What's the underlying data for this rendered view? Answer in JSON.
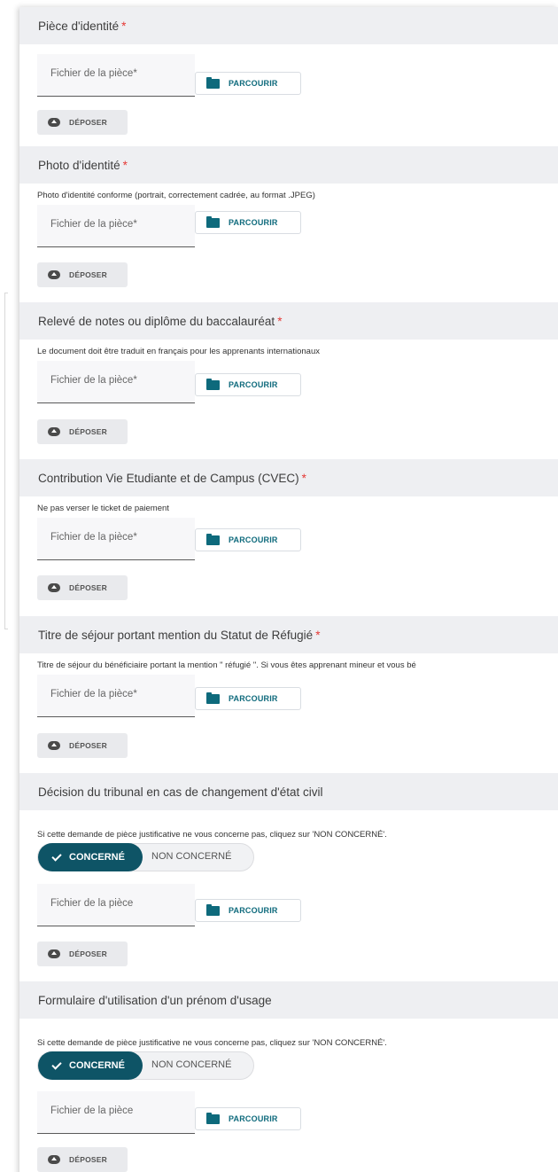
{
  "sections": [
    {
      "title": "Pièce d'identité",
      "required": "*",
      "description": "",
      "file_placeholder": "Fichier de la pièce*",
      "browse_label": "PARCOURIR",
      "upload_label": "DÉPOSER"
    },
    {
      "title": "Photo d'identité",
      "required": "*",
      "description": "Photo d'identité conforme (portrait, correctement cadrée, au format .JPEG)",
      "file_placeholder": "Fichier de la pièce*",
      "browse_label": "PARCOURIR",
      "upload_label": "DÉPOSER"
    },
    {
      "title": "Relevé de notes ou diplôme du baccalauréat",
      "required": "*",
      "description": "Le document doit être traduit en français pour les apprenants internationaux",
      "file_placeholder": "Fichier de la pièce*",
      "browse_label": "PARCOURIR",
      "upload_label": "DÉPOSER"
    },
    {
      "title": "Contribution Vie Etudiante et de Campus (CVEC)",
      "required": "*",
      "description": "Ne pas verser le ticket de paiement",
      "file_placeholder": "Fichier de la pièce*",
      "browse_label": "PARCOURIR",
      "upload_label": "DÉPOSER"
    },
    {
      "title": "Titre de séjour portant mention du Statut de Réfugié",
      "required": "*",
      "description": "Titre de séjour du bénéficiaire portant la mention \" réfugié \". Si vous êtes apprenant mineur et vous bé",
      "file_placeholder": "Fichier de la pièce*",
      "browse_label": "PARCOURIR",
      "upload_label": "DÉPOSER"
    },
    {
      "title": "Décision du tribunal en cas de changement d'état civil",
      "required": "",
      "description": "Si cette demande de pièce justificative ne vous concerne pas, cliquez sur 'NON CONCERNÉ'.",
      "toggle_on": "CONCERNÉ",
      "toggle_off": "NON CONCERNÉ",
      "file_placeholder": "Fichier de la pièce",
      "browse_label": "PARCOURIR",
      "upload_label": "DÉPOSER"
    },
    {
      "title": "Formulaire d'utilisation d'un prénom d'usage",
      "required": "",
      "description": "Si cette demande de pièce justificative ne vous concerne pas, cliquez sur 'NON CONCERNÉ'.",
      "toggle_on": "CONCERNÉ",
      "toggle_off": "NON CONCERNÉ",
      "file_placeholder": "Fichier de la pièce",
      "browse_label": "PARCOURIR",
      "upload_label": "DÉPOSER"
    }
  ],
  "colors": {
    "accent": "#0e6a7c",
    "toggle_active": "#0e5466",
    "required": "#e53935",
    "header_bg": "#eeeff2"
  },
  "icons": {
    "browse": "folder-icon",
    "upload": "cloud-upload-icon",
    "toggle": "check-icon"
  }
}
